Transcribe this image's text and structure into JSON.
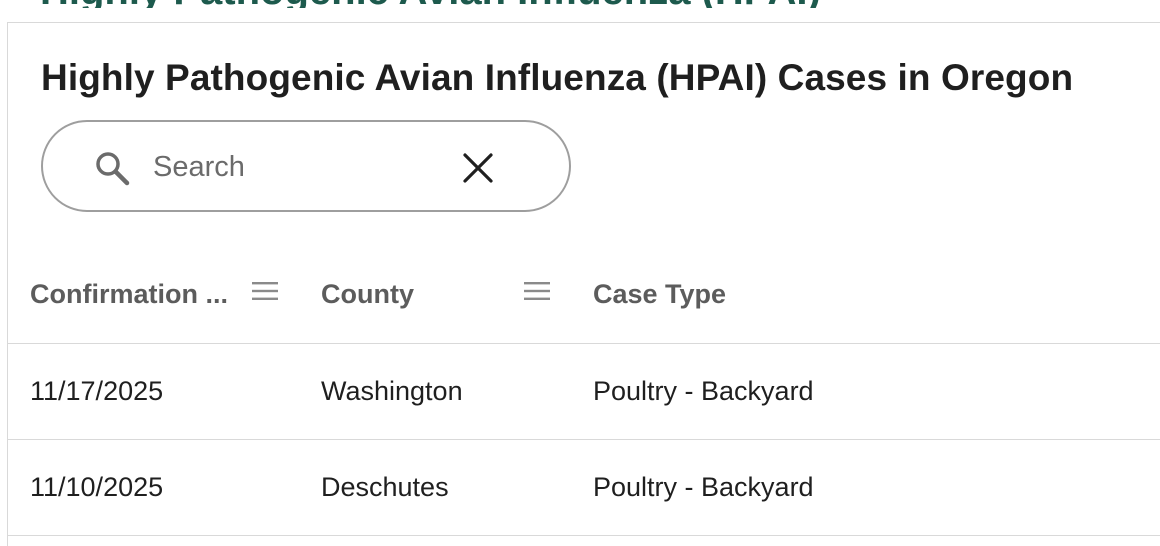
{
  "page": {
    "clipped_heading": "Highly Pathogenic Avian Influenza (HPAI)"
  },
  "card": {
    "title": "Highly Pathogenic Avian Influenza (HPAI) Cases in Oregon"
  },
  "search": {
    "placeholder": "Search",
    "value": "",
    "search_icon": "search-icon",
    "clear_icon": "close-icon"
  },
  "table": {
    "columns": [
      {
        "label": "Confirmation ...",
        "menu_icon": "menu-icon"
      },
      {
        "label": "County",
        "menu_icon": "menu-icon"
      },
      {
        "label": "Case Type"
      }
    ],
    "rows": [
      [
        "11/17/2025",
        "Washington",
        "Poultry - Backyard"
      ],
      [
        "11/10/2025",
        "Deschutes",
        "Poultry - Backyard"
      ]
    ]
  },
  "colors": {
    "heading_accent": "#1d5a4d",
    "title_text": "#1f1f1f",
    "header_text": "#5c5c5c",
    "border": "#d9d9d9",
    "search_border": "#9e9e9e"
  }
}
